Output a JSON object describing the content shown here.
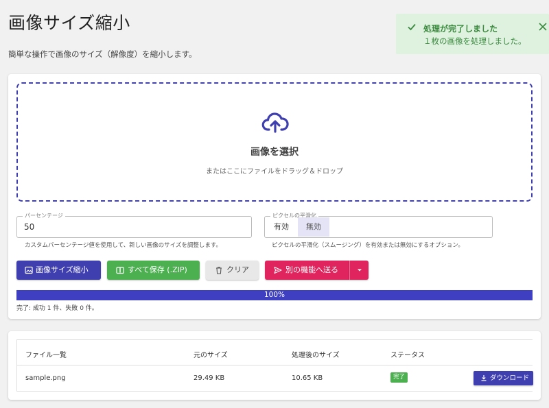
{
  "page": {
    "title": "画像サイズ縮小",
    "description": "簡単な操作で画像のサイズ（解像度）を縮小します。"
  },
  "toast": {
    "title": "処理が完了しました",
    "message": "１枚の画像を処理しました。"
  },
  "dropzone": {
    "title": "画像を選択",
    "subtitle": "またはここにファイルをドラッグ＆ドロップ"
  },
  "percentage": {
    "label": "パーセンテージ",
    "value": "50",
    "help": "カスタムパーセンテージ値を使用して、新しい画像のサイズを調整します。"
  },
  "smoothing": {
    "label": "ピクセルの平滑化",
    "options": [
      "有効",
      "無効"
    ],
    "selected": "無効",
    "help": "ピクセルの平滑化（スムージング）を有効または無効にするオプション。"
  },
  "buttons": {
    "shrink": "画像サイズ縮小",
    "save_zip": "すべて保存 (.ZIP)",
    "clear": "クリア",
    "send": "別の機能へ送る"
  },
  "progress": {
    "value": 100,
    "label": "100%",
    "status": "完了: 成功 1 件、失敗 0 件。"
  },
  "table": {
    "headers": [
      "ファイル一覧",
      "元のサイズ",
      "処理後のサイズ",
      "ステータス"
    ],
    "rows": [
      {
        "name": "sample.png",
        "original_size": "29.49 KB",
        "processed_size": "10.65 KB",
        "status": "完了",
        "action": "ダウンロード"
      }
    ]
  },
  "colors": {
    "primary": "#3f3fb0",
    "success": "#4caf50",
    "accent": "#e0245e"
  }
}
